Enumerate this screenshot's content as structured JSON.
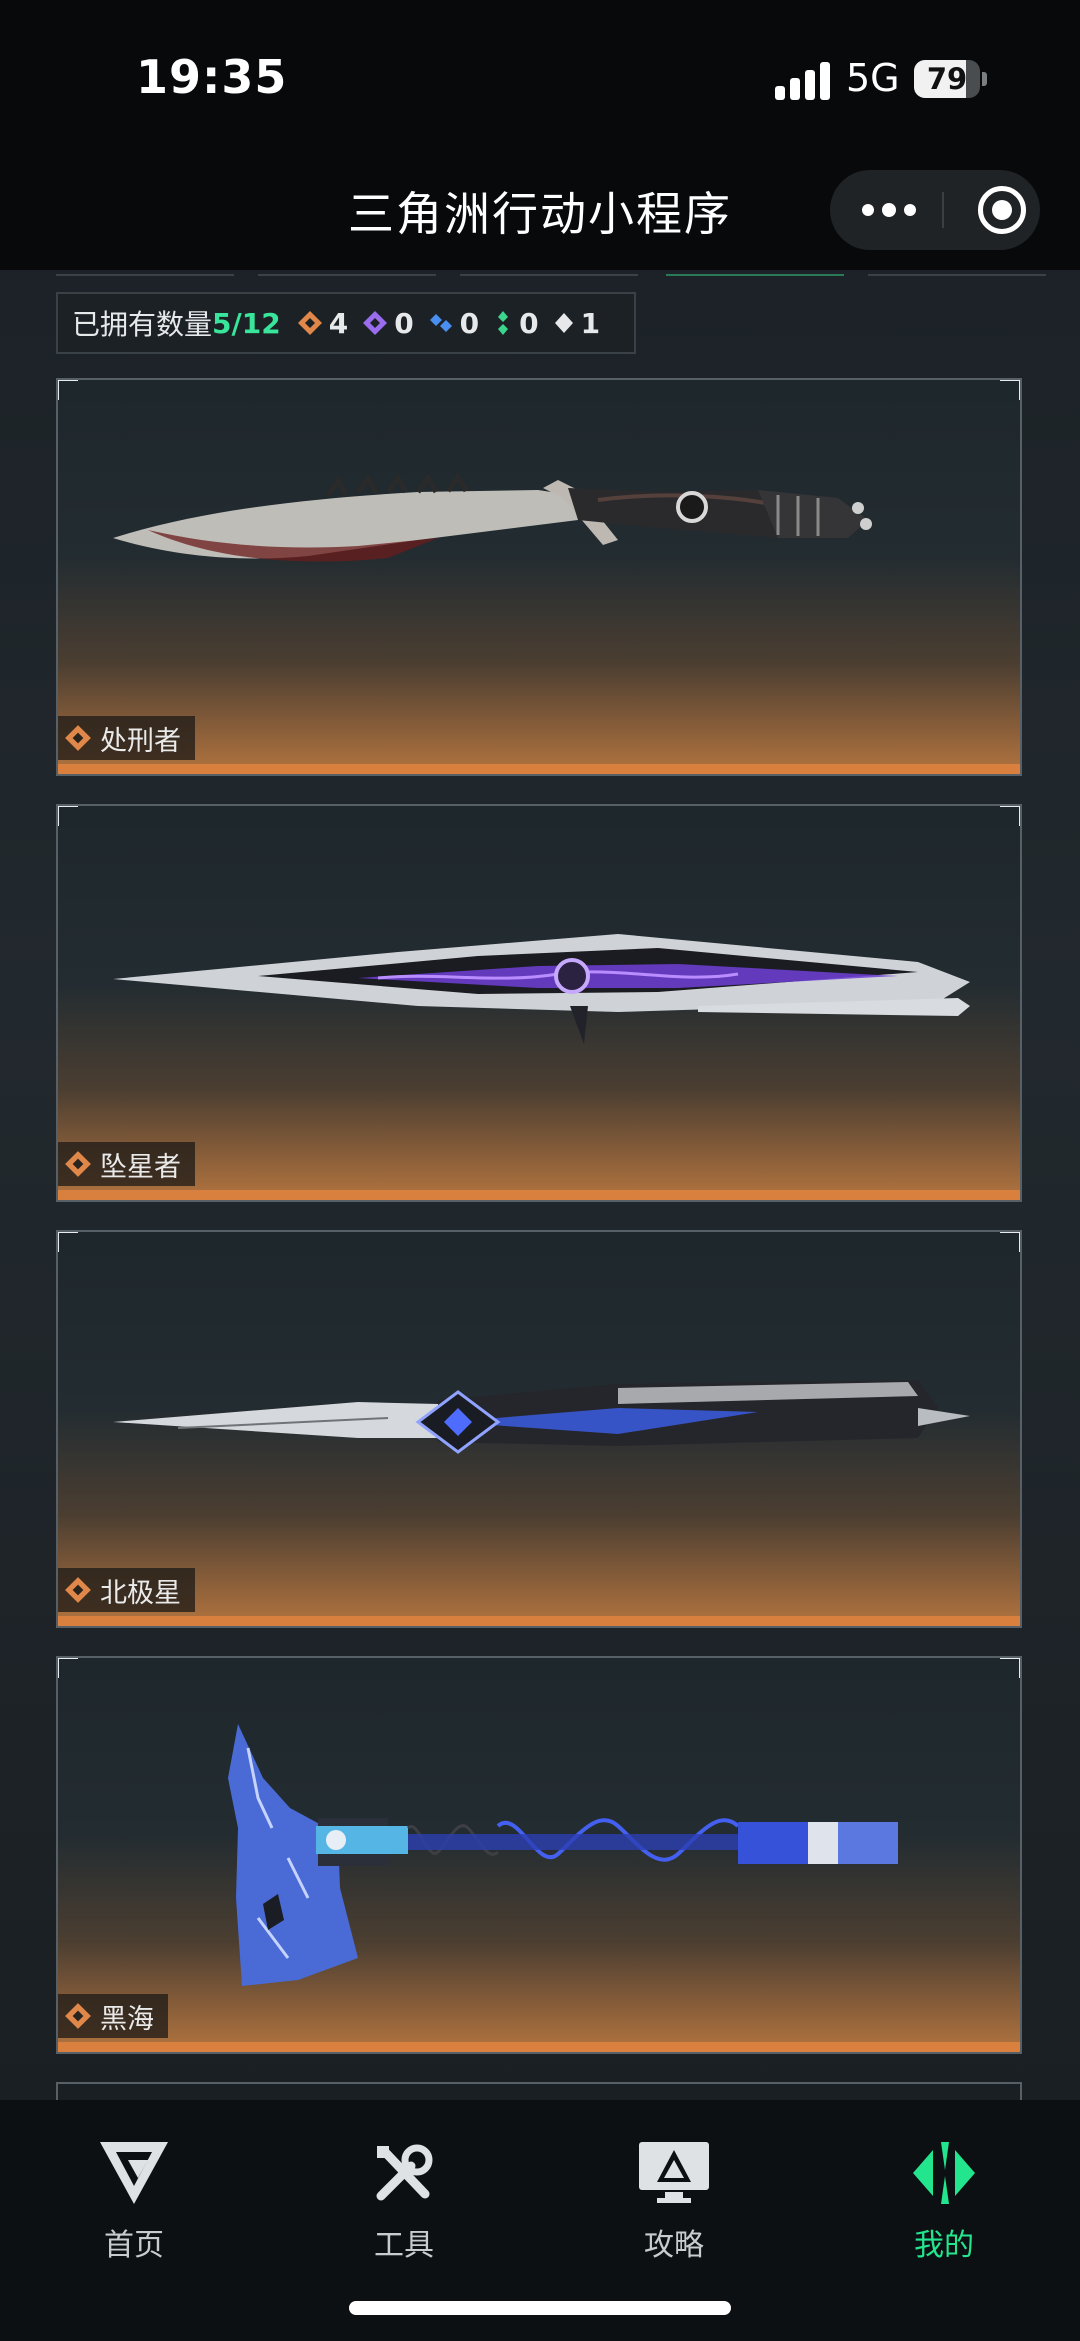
{
  "status_bar": {
    "time": "19:35",
    "network": "5G",
    "battery": "79",
    "battery_level": 0.79
  },
  "title_bar": {
    "title": "三角洲行动小程序",
    "more_icon": "more-dots-icon",
    "close_icon": "target-icon"
  },
  "owned": {
    "label": "已拥有数量",
    "count": "5/12",
    "rarities": [
      {
        "icon": "orange-diamond-icon",
        "color": "#e0874a",
        "value": "4"
      },
      {
        "icon": "purple-diamond-icon",
        "color": "#9a6cf0",
        "value": "0"
      },
      {
        "icon": "blue-diamond-icon",
        "color": "#4a8ef0",
        "value": "0"
      },
      {
        "icon": "green-diamond-icon",
        "color": "#3bd58e",
        "value": "0"
      },
      {
        "icon": "white-diamond-icon",
        "color": "#e6e8ea",
        "value": "1"
      }
    ]
  },
  "items": [
    {
      "name": "处刑者",
      "rarity_icon": "orange-diamond-icon"
    },
    {
      "name": "坠星者",
      "rarity_icon": "orange-diamond-icon"
    },
    {
      "name": "北极星",
      "rarity_icon": "orange-diamond-icon"
    },
    {
      "name": "黑海",
      "rarity_icon": "orange-diamond-icon"
    }
  ],
  "tabbar": [
    {
      "label": "首页",
      "icon": "delta-logo-icon",
      "active": false
    },
    {
      "label": "工具",
      "icon": "tools-icon",
      "active": false
    },
    {
      "label": "攻略",
      "icon": "guide-monitor-icon",
      "active": false
    },
    {
      "label": "我的",
      "icon": "profile-diamond-icon",
      "active": true
    }
  ],
  "colors": {
    "accent": "#22e58e",
    "rarity_orange": "#d9803e",
    "background": "#16191c"
  }
}
